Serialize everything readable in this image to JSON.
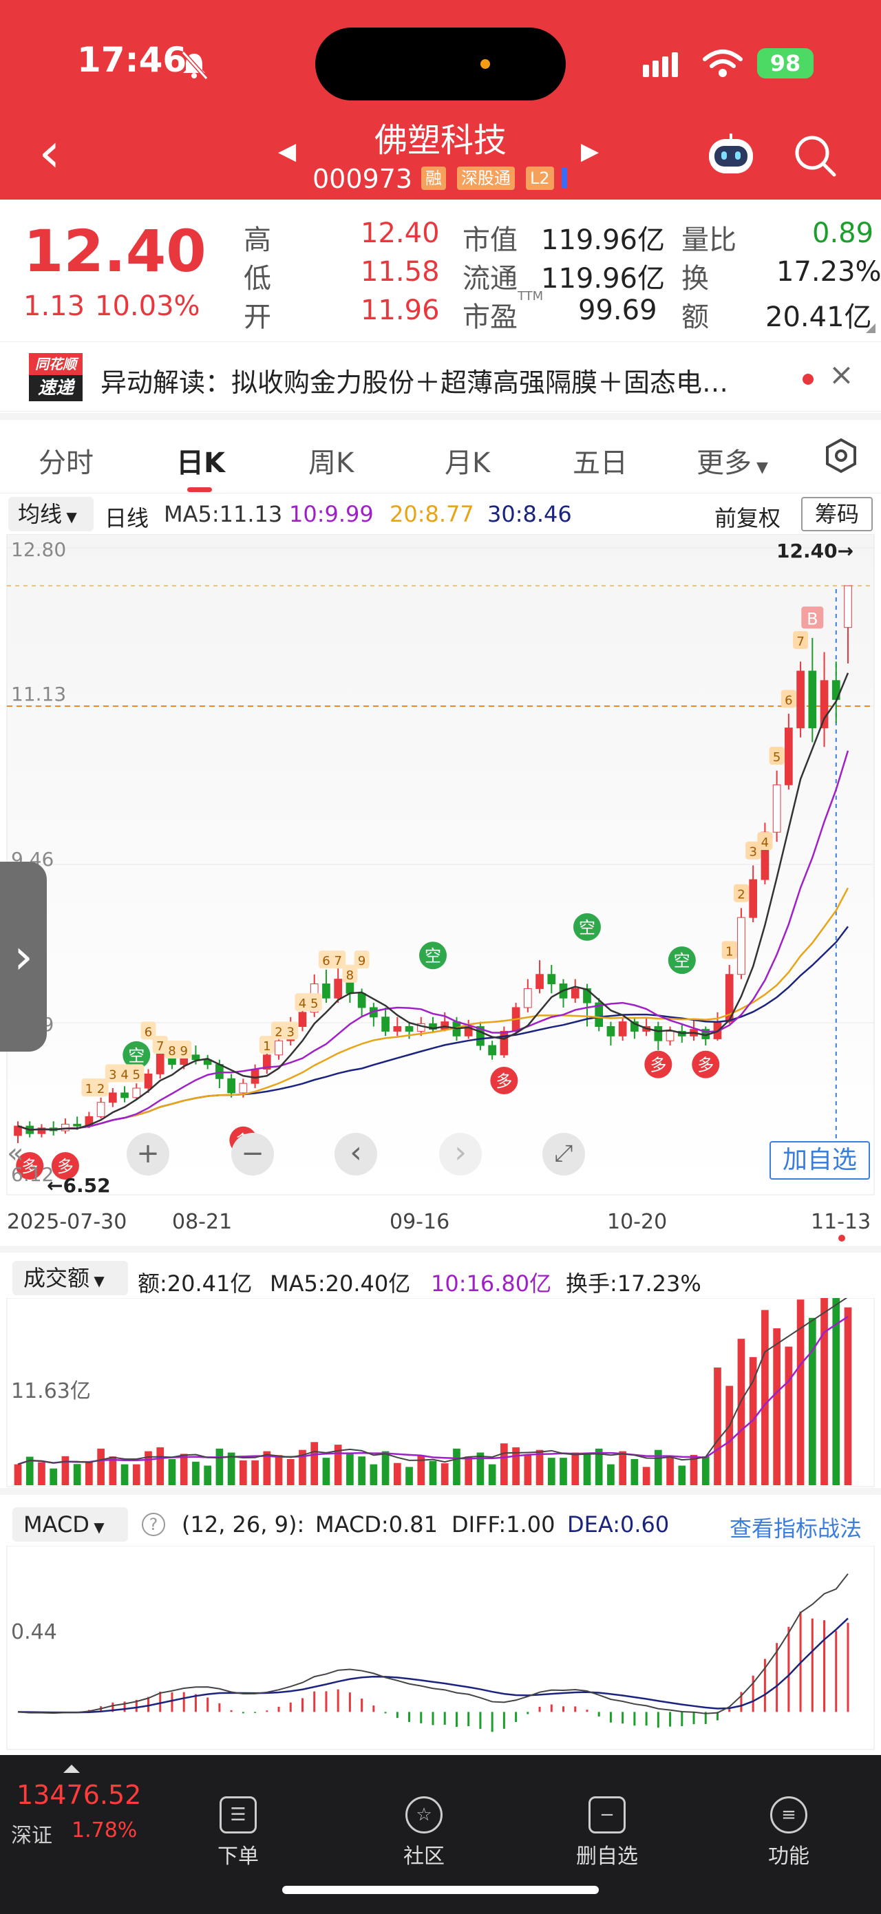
{
  "status_bar": {
    "time": "17:46",
    "battery": "98"
  },
  "header": {
    "title": "佛塑科技",
    "code": "000973",
    "tags": [
      "融",
      "深股通",
      "L2"
    ],
    "back": "‹",
    "prev": "◀",
    "next": "▶"
  },
  "quote": {
    "price": "12.40",
    "change": "1.13",
    "change_pct": "10.03%",
    "high_label": "高",
    "high": "12.40",
    "low_label": "低",
    "low": "11.58",
    "open_label": "开",
    "open": "11.96",
    "mktcap_label": "市值",
    "mktcap": "119.96亿",
    "float_label": "流通",
    "float": "119.96亿",
    "pe_label": "市盈",
    "pe_sup": "TTM",
    "pe": "99.69",
    "vol_ratio_label": "量比",
    "vol_ratio": "0.89",
    "turnover_label": "换",
    "turnover": "17.23%",
    "amount_label": "额",
    "amount": "20.41亿"
  },
  "banner": {
    "logo_top": "同花顺",
    "logo_bottom": "速递",
    "text": "异动解读：拟收购金力股份＋超薄高强隔膜＋固态电…",
    "close": "×"
  },
  "tabs": [
    "分时",
    "日K",
    "周K",
    "月K",
    "五日",
    "更多"
  ],
  "ma_bar": {
    "selector": "均线",
    "period": "日线",
    "ma5": "MA5:11.13",
    "ma10": "10:9.99",
    "ma20": "20:8.77",
    "ma30": "30:8.46",
    "adjust": "前复权",
    "chips": "筹码"
  },
  "kchart": {
    "y_top": "12.80",
    "y_mid": "11.13",
    "y_low": "9.46",
    "y_under": "7.79",
    "y_min": "6.12",
    "last_label": "12.40→",
    "low_label": "←6.52",
    "dates": [
      "2025-07-30",
      "08-21",
      "09-16",
      "10-20",
      "11-13"
    ],
    "add_watch": "加自选",
    "signal_kong": "空",
    "signal_duo": "多",
    "signal_buy": "B",
    "zoom_out": "−",
    "zoom_in": "+",
    "prev": "‹",
    "next": "›",
    "fullscreen": "⤢"
  },
  "volume": {
    "selector": "成交额",
    "amount": "额:20.41亿",
    "ma5": "MA5:20.40亿",
    "ma10": "10:16.80亿",
    "turnover": "换手:17.23%",
    "y_label": "11.63亿"
  },
  "macd": {
    "selector": "MACD",
    "help": "?",
    "params": "(12, 26, 9):",
    "macd": "MACD:0.81",
    "diff": "DIFF:1.00",
    "dea": "DEA:0.60",
    "link": "查看指标战法",
    "y_label": "0.44"
  },
  "bottom_nav": {
    "index_value": "13476.52",
    "index_name": "深证",
    "index_change": "1.78%",
    "items": [
      "下单",
      "社区",
      "删自选",
      "功能"
    ]
  },
  "colors": {
    "up": "#e8383d",
    "down": "#1b9e2b",
    "header": "#e8383d"
  },
  "chart_data": {
    "type": "candlestick",
    "y_range": [
      6.12,
      12.8
    ],
    "candles": [
      {
        "o": 6.6,
        "c": 6.7,
        "h": 6.75,
        "l": 6.52
      },
      {
        "o": 6.7,
        "c": 6.62,
        "h": 6.75,
        "l": 6.58
      },
      {
        "o": 6.62,
        "c": 6.68,
        "h": 6.72,
        "l": 6.58
      },
      {
        "o": 6.68,
        "c": 6.65,
        "h": 6.75,
        "l": 6.6
      },
      {
        "o": 6.65,
        "c": 6.72,
        "h": 6.78,
        "l": 6.62
      },
      {
        "o": 6.72,
        "c": 6.7,
        "h": 6.8,
        "l": 6.66
      },
      {
        "o": 6.7,
        "c": 6.8,
        "h": 6.85,
        "l": 6.68
      },
      {
        "o": 6.8,
        "c": 6.95,
        "h": 7.0,
        "l": 6.78
      },
      {
        "o": 6.95,
        "c": 7.05,
        "h": 7.1,
        "l": 6.9
      },
      {
        "o": 7.05,
        "c": 7.0,
        "h": 7.12,
        "l": 6.95
      },
      {
        "o": 7.0,
        "c": 7.1,
        "h": 7.15,
        "l": 6.98
      },
      {
        "o": 7.1,
        "c": 7.25,
        "h": 7.3,
        "l": 7.05
      },
      {
        "o": 7.25,
        "c": 7.5,
        "h": 7.6,
        "l": 7.2
      },
      {
        "o": 7.5,
        "c": 7.35,
        "h": 7.55,
        "l": 7.3
      },
      {
        "o": 7.35,
        "c": 7.45,
        "h": 7.55,
        "l": 7.3
      },
      {
        "o": 7.45,
        "c": 7.4,
        "h": 7.55,
        "l": 7.35
      },
      {
        "o": 7.4,
        "c": 7.35,
        "h": 7.45,
        "l": 7.3
      },
      {
        "o": 7.35,
        "c": 7.2,
        "h": 7.4,
        "l": 7.1
      },
      {
        "o": 7.2,
        "c": 7.05,
        "h": 7.25,
        "l": 7.0
      },
      {
        "o": 7.05,
        "c": 7.15,
        "h": 7.2,
        "l": 7.0
      },
      {
        "o": 7.15,
        "c": 7.3,
        "h": 7.35,
        "l": 7.1
      },
      {
        "o": 7.3,
        "c": 7.45,
        "h": 7.5,
        "l": 7.25
      },
      {
        "o": 7.45,
        "c": 7.6,
        "h": 7.65,
        "l": 7.4
      },
      {
        "o": 7.6,
        "c": 7.75,
        "h": 7.85,
        "l": 7.55
      },
      {
        "o": 7.75,
        "c": 7.9,
        "h": 8.0,
        "l": 7.7
      },
      {
        "o": 7.9,
        "c": 8.2,
        "h": 8.3,
        "l": 7.85
      },
      {
        "o": 8.2,
        "c": 8.05,
        "h": 8.35,
        "l": 8.0
      },
      {
        "o": 8.05,
        "c": 8.25,
        "h": 8.4,
        "l": 8.0
      },
      {
        "o": 8.25,
        "c": 8.1,
        "h": 8.3,
        "l": 8.0
      },
      {
        "o": 8.1,
        "c": 7.95,
        "h": 8.15,
        "l": 7.85
      },
      {
        "o": 7.95,
        "c": 7.85,
        "h": 8.0,
        "l": 7.75
      },
      {
        "o": 7.85,
        "c": 7.7,
        "h": 7.95,
        "l": 7.65
      },
      {
        "o": 7.7,
        "c": 7.75,
        "h": 7.85,
        "l": 7.65
      },
      {
        "o": 7.75,
        "c": 7.7,
        "h": 7.8,
        "l": 7.62
      },
      {
        "o": 7.7,
        "c": 7.78,
        "h": 7.85,
        "l": 7.65
      },
      {
        "o": 7.78,
        "c": 7.72,
        "h": 7.85,
        "l": 7.68
      },
      {
        "o": 7.72,
        "c": 7.8,
        "h": 7.9,
        "l": 7.7
      },
      {
        "o": 7.8,
        "c": 7.65,
        "h": 7.85,
        "l": 7.6
      },
      {
        "o": 7.65,
        "c": 7.75,
        "h": 7.82,
        "l": 7.62
      },
      {
        "o": 7.75,
        "c": 7.55,
        "h": 7.8,
        "l": 7.5
      },
      {
        "o": 7.55,
        "c": 7.45,
        "h": 7.6,
        "l": 7.4
      },
      {
        "o": 7.45,
        "c": 7.7,
        "h": 7.75,
        "l": 7.42
      },
      {
        "o": 7.7,
        "c": 7.95,
        "h": 8.0,
        "l": 7.68
      },
      {
        "o": 7.95,
        "c": 8.15,
        "h": 8.25,
        "l": 7.9
      },
      {
        "o": 8.15,
        "c": 8.3,
        "h": 8.45,
        "l": 8.1
      },
      {
        "o": 8.3,
        "c": 8.2,
        "h": 8.4,
        "l": 8.1
      },
      {
        "o": 8.2,
        "c": 8.05,
        "h": 8.25,
        "l": 7.95
      },
      {
        "o": 8.05,
        "c": 8.15,
        "h": 8.25,
        "l": 8.0
      },
      {
        "o": 8.15,
        "c": 8.0,
        "h": 8.2,
        "l": 7.75
      },
      {
        "o": 8.0,
        "c": 7.75,
        "h": 8.05,
        "l": 7.7
      },
      {
        "o": 7.75,
        "c": 7.65,
        "h": 7.8,
        "l": 7.55
      },
      {
        "o": 7.65,
        "c": 7.8,
        "h": 7.85,
        "l": 7.6
      },
      {
        "o": 7.8,
        "c": 7.7,
        "h": 7.85,
        "l": 7.62
      },
      {
        "o": 7.7,
        "c": 7.75,
        "h": 7.85,
        "l": 7.65
      },
      {
        "o": 7.75,
        "c": 7.6,
        "h": 7.8,
        "l": 7.5
      },
      {
        "o": 7.6,
        "c": 7.7,
        "h": 7.75,
        "l": 7.55
      },
      {
        "o": 7.7,
        "c": 7.65,
        "h": 7.78,
        "l": 7.58
      },
      {
        "o": 7.65,
        "c": 7.72,
        "h": 7.82,
        "l": 7.6
      },
      {
        "o": 7.72,
        "c": 7.62,
        "h": 7.75,
        "l": 7.55
      },
      {
        "o": 7.62,
        "c": 7.8,
        "h": 7.9,
        "l": 7.6
      },
      {
        "o": 7.8,
        "c": 8.3,
        "h": 8.4,
        "l": 7.78
      },
      {
        "o": 8.3,
        "c": 8.9,
        "h": 9.0,
        "l": 8.25
      },
      {
        "o": 8.9,
        "c": 9.3,
        "h": 9.45,
        "l": 8.85
      },
      {
        "o": 9.3,
        "c": 9.8,
        "h": 9.9,
        "l": 9.25
      },
      {
        "o": 9.8,
        "c": 10.3,
        "h": 10.45,
        "l": 9.7
      },
      {
        "o": 10.3,
        "c": 10.9,
        "h": 11.05,
        "l": 10.25
      },
      {
        "o": 10.9,
        "c": 11.5,
        "h": 11.6,
        "l": 10.8
      },
      {
        "o": 11.5,
        "c": 10.9,
        "h": 11.85,
        "l": 10.75
      },
      {
        "o": 10.9,
        "c": 11.4,
        "h": 11.7,
        "l": 10.7
      },
      {
        "o": 11.4,
        "c": 11.2,
        "h": 11.6,
        "l": 10.95
      },
      {
        "o": 11.96,
        "c": 12.4,
        "h": 12.4,
        "l": 11.58
      }
    ],
    "ma5_end": 11.13,
    "ma10_end": 9.99,
    "ma20_end": 8.77,
    "ma30_end": 8.46
  }
}
